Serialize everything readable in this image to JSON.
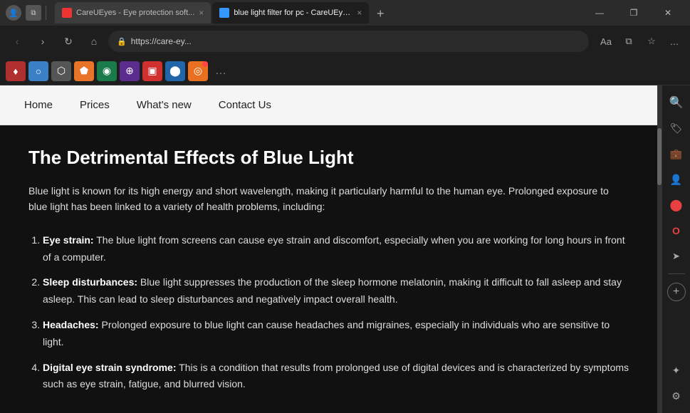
{
  "browser": {
    "title_bar": {
      "tab1": {
        "label": "CareUEyes - Eye protection soft...",
        "favicon_color": "#cc3333",
        "close": "×"
      },
      "tab2": {
        "label": "blue light filter for pc - CareUEye...",
        "favicon_color": "#3399ff",
        "close": "×",
        "active": true
      },
      "new_tab_btn": "+",
      "win_min": "—",
      "win_max": "❐",
      "win_close": "✕"
    },
    "nav_bar": {
      "back": "‹",
      "forward": "›",
      "reload": "↻",
      "home": "⌂",
      "url": "https://care-ey...",
      "url_full": "https://care-ey...",
      "read_mode": "Aa",
      "split_view": "⧉",
      "favorites": "☆",
      "extensions_btn": "…"
    },
    "ext_bar": {
      "icons": [
        "♦",
        "○",
        "⬡",
        "⬟",
        "◉",
        "⊕",
        "▣",
        "⊞",
        "⊟"
      ],
      "overflow": "…"
    }
  },
  "website": {
    "nav": {
      "items": [
        "Home",
        "Prices",
        "What's new",
        "Contact Us"
      ]
    },
    "content": {
      "title": "The Detrimental Effects of Blue Light",
      "intro": "Blue light is known for its high energy and short wavelength, making it particularly harmful to the human eye. Prolonged exposure to blue light has been linked to a variety of health problems, including:",
      "list": [
        {
          "bold": "Eye strain:",
          "text": " The blue light from screens can cause eye strain and discomfort, especially when you are working for long hours in front of a computer."
        },
        {
          "bold": "Sleep disturbances:",
          "text": " Blue light suppresses the production of the sleep hormone melatonin, making it difficult to fall asleep and stay asleep. This can lead to sleep disturbances and negatively impact overall health."
        },
        {
          "bold": "Headaches:",
          "text": " Prolonged exposure to blue light can cause headaches and migraines, especially in individuals who are sensitive to light."
        },
        {
          "bold": "Digital eye strain syndrome:",
          "text": " This is a condition that results from prolonged use of digital devices and is characterized by symptoms such as eye strain, fatigue, and blurred vision."
        }
      ]
    }
  },
  "sidebar": {
    "icons": [
      {
        "name": "search",
        "glyph": "🔍"
      },
      {
        "name": "tag",
        "glyph": "🏷"
      },
      {
        "name": "briefcase",
        "glyph": "💼"
      },
      {
        "name": "person",
        "glyph": "👤"
      },
      {
        "name": "circle-logo",
        "glyph": "⬤"
      },
      {
        "name": "office",
        "glyph": "🅾"
      },
      {
        "name": "arrow",
        "glyph": "➤"
      },
      {
        "name": "ai",
        "glyph": "✦"
      },
      {
        "name": "gear",
        "glyph": "⚙"
      }
    ]
  }
}
